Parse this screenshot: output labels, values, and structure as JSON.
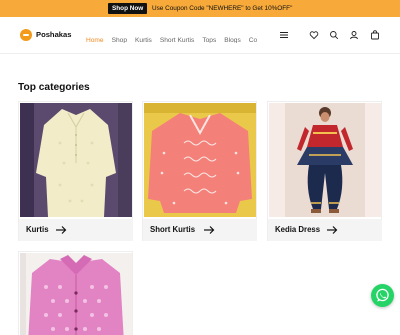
{
  "announcement": {
    "button_label": "Shop Now",
    "promo_text": "Use Coupon Code \"NEWHERE\" to Get 10%OFF\""
  },
  "header": {
    "brand": "Poshakas",
    "nav": [
      "Home",
      "Shop",
      "Kurtis",
      "Short Kurtis",
      "Tops",
      "Blogs",
      "Co"
    ],
    "active_nav": "Home",
    "icons": [
      "menu-icon",
      "wishlist-heart-icon",
      "search-icon",
      "account-icon",
      "cart-bag-icon"
    ]
  },
  "main": {
    "section_title": "Top categories",
    "categories": [
      {
        "label": "Kurtis",
        "image": "pale yellow embroidered kurti on hanger"
      },
      {
        "label": "Short Kurtis",
        "image": "pink chikankari short kurti"
      },
      {
        "label": "Kedia Dress",
        "image": "model in red and navy kedia dress"
      },
      {
        "label": "",
        "image": "pink printed kurti with collar on hanger"
      }
    ]
  },
  "colors": {
    "accent": "#f08a24",
    "announcement_bg": "#f7a93a",
    "whatsapp": "#25d366"
  }
}
